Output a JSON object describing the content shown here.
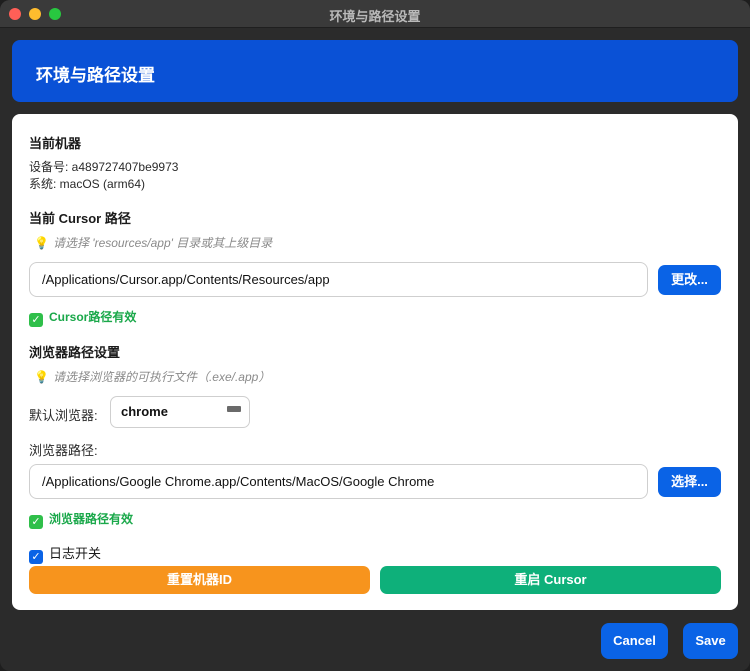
{
  "window": {
    "title": "环境与路径设置"
  },
  "header": {
    "title": "环境与路径设置"
  },
  "machine": {
    "heading": "当前机器",
    "device_line": "设备号: a489727407be9973",
    "system_line": "系统: macOS (arm64)"
  },
  "cursor_path": {
    "heading": "当前 Cursor 路径",
    "hint": "请选择 'resources/app' 目录或其上级目录",
    "value": "/Applications/Cursor.app/Contents/Resources/app",
    "change_button": "更改...",
    "status": "Cursor路径有效"
  },
  "browser": {
    "heading": "浏览器路径设置",
    "hint": "请选择浏览器的可执行文件（.exe/.app）",
    "default_label": "默认浏览器:",
    "default_value": "chrome",
    "path_label": "浏览器路径:",
    "path_value": "/Applications/Google Chrome.app/Contents/MacOS/Google Chrome",
    "choose_button": "选择...",
    "status": "浏览器路径有效"
  },
  "log": {
    "label": "日志开关",
    "checked": true
  },
  "actions": {
    "reset_machine_id": "重置机器ID",
    "restart_cursor": "重启 Cursor"
  },
  "footer": {
    "cancel": "Cancel",
    "save": "Save"
  },
  "colors": {
    "accent": "#0a63e6",
    "header": "#0a51d6",
    "orange": "#f7941d",
    "green": "#0eb07a",
    "valid": "#1aa84a"
  },
  "icons": {
    "hint": "lightbulb-icon",
    "valid": "check-square-icon",
    "checkbox": "checkbox-checked-icon"
  }
}
